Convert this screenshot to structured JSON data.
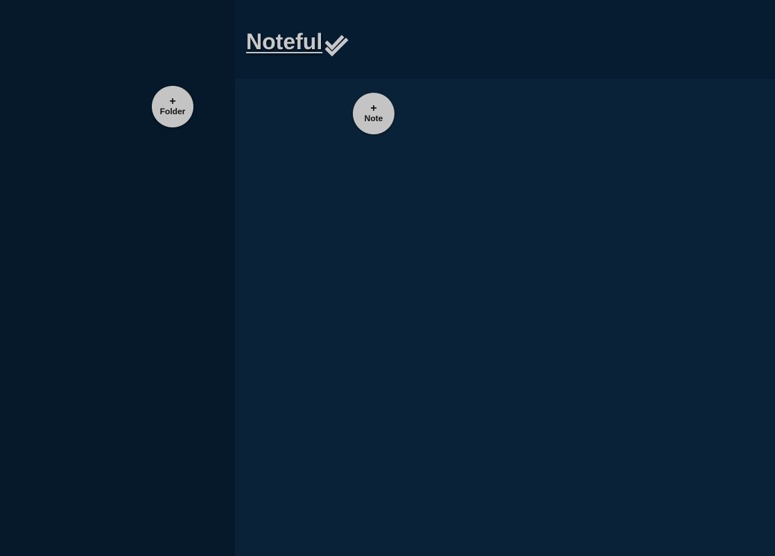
{
  "header": {
    "title": "Noteful",
    "title_icon": "double-check-icon"
  },
  "sidebar": {
    "add_folder": {
      "icon": "plus-icon",
      "icon_glyph": "+",
      "label": "Folder"
    }
  },
  "main": {
    "add_note": {
      "icon": "plus-icon",
      "icon_glyph": "+",
      "label": "Note"
    }
  },
  "colors": {
    "sidebar_bg": "#05192a",
    "header_bg": "#061c31",
    "main_bg": "#0a2238",
    "button_bg": "#c4c4c4",
    "title_text": "#c8c8c8"
  }
}
